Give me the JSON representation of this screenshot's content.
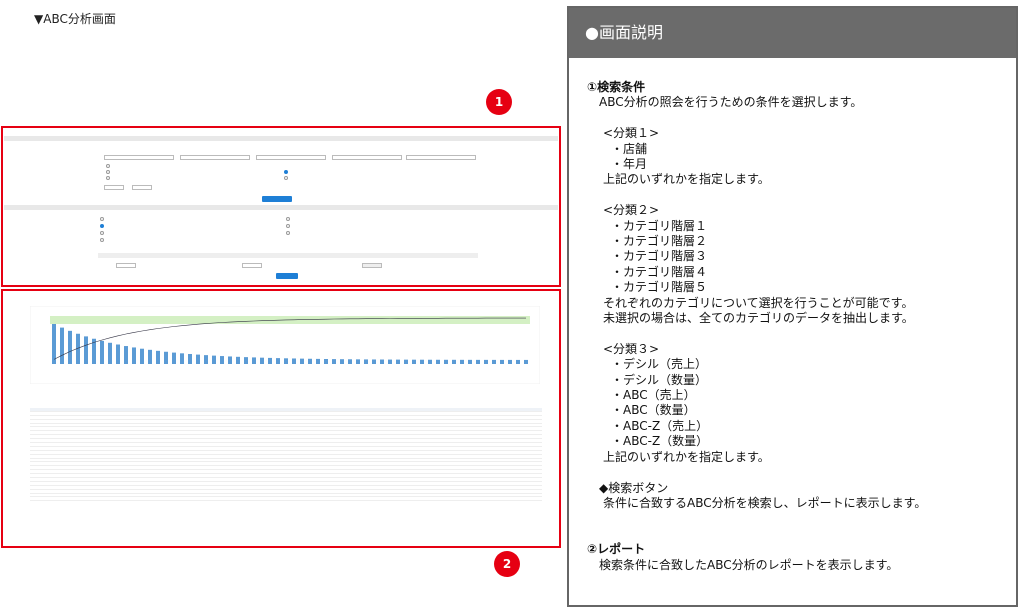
{
  "page": {
    "title": "▼ABC分析画面"
  },
  "markers": {
    "one": "1",
    "two": "2"
  },
  "panel": {
    "header": "●画面説明",
    "lines": [
      {
        "text": "①検索条件",
        "bold": true,
        "indent": 0
      },
      {
        "text": "ABC分析の照会を行うための条件を選択します。",
        "bold": false,
        "indent": 1
      },
      {
        "text": "",
        "bold": false,
        "indent": 0
      },
      {
        "text": "<分類１>",
        "bold": false,
        "indent": 2
      },
      {
        "text": "・店舗",
        "bold": false,
        "indent": 3
      },
      {
        "text": "・年月",
        "bold": false,
        "indent": 3
      },
      {
        "text": "上記のいずれかを指定します。",
        "bold": false,
        "indent": 2
      },
      {
        "text": "",
        "bold": false,
        "indent": 0
      },
      {
        "text": "<分類２>",
        "bold": false,
        "indent": 2
      },
      {
        "text": "・カテゴリ階層１",
        "bold": false,
        "indent": 3
      },
      {
        "text": "・カテゴリ階層２",
        "bold": false,
        "indent": 3
      },
      {
        "text": "・カテゴリ階層３",
        "bold": false,
        "indent": 3
      },
      {
        "text": "・カテゴリ階層４",
        "bold": false,
        "indent": 3
      },
      {
        "text": "・カテゴリ階層５",
        "bold": false,
        "indent": 3
      },
      {
        "text": "それぞれのカテゴリについて選択を行うことが可能です。",
        "bold": false,
        "indent": 2
      },
      {
        "text": "未選択の場合は、全てのカテゴリのデータを抽出します。",
        "bold": false,
        "indent": 2
      },
      {
        "text": "",
        "bold": false,
        "indent": 0
      },
      {
        "text": "<分類３>",
        "bold": false,
        "indent": 2
      },
      {
        "text": "・デシル（売上）",
        "bold": false,
        "indent": 3
      },
      {
        "text": "・デシル（数量）",
        "bold": false,
        "indent": 3
      },
      {
        "text": "・ABC（売上）",
        "bold": false,
        "indent": 3
      },
      {
        "text": "・ABC（数量）",
        "bold": false,
        "indent": 3
      },
      {
        "text": "・ABC-Z（売上）",
        "bold": false,
        "indent": 3
      },
      {
        "text": "・ABC-Z（数量）",
        "bold": false,
        "indent": 3
      },
      {
        "text": "上記のいずれかを指定します。",
        "bold": false,
        "indent": 2
      },
      {
        "text": "",
        "bold": false,
        "indent": 0
      },
      {
        "text": "◆検索ボタン",
        "bold": false,
        "indent": 1
      },
      {
        "text": "条件に合致するABC分析を検索し、レポートに表示します。",
        "bold": false,
        "indent": 2
      },
      {
        "text": "",
        "bold": false,
        "indent": 0
      },
      {
        "text": "",
        "bold": false,
        "indent": 0
      },
      {
        "text": "②レポート",
        "bold": true,
        "indent": 0
      },
      {
        "text": "検索条件に合致したABC分析のレポートを表示します。",
        "bold": false,
        "indent": 1
      }
    ]
  },
  "colors": {
    "accent": "#e60012",
    "header": "#6b6b6b",
    "button": "#1e7fd6"
  }
}
